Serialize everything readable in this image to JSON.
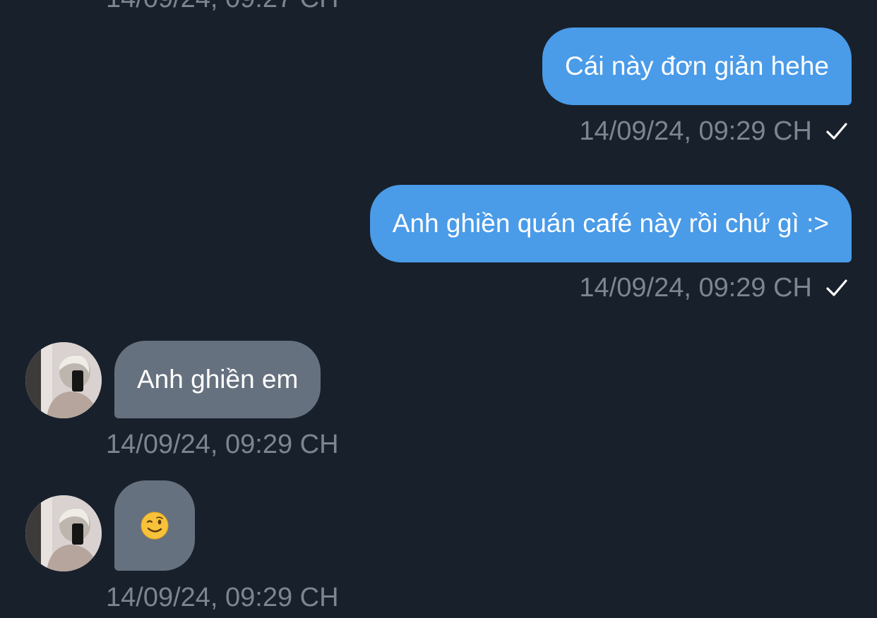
{
  "messages": [
    {
      "direction": "outgoing",
      "text": "Cái này đơn giản hehe",
      "timestamp": "14/09/24, 09:29 CH",
      "status_icon": "check-icon"
    },
    {
      "direction": "outgoing",
      "text": "Anh ghiền quán café này rồi chứ gì :>",
      "timestamp": "14/09/24, 09:29 CH",
      "status_icon": "check-icon"
    },
    {
      "direction": "incoming",
      "text": "Anh ghiền em",
      "timestamp": "14/09/24, 09:29 CH",
      "avatar": "avatar-photo"
    },
    {
      "direction": "incoming",
      "emoji": "winking-face-emoji",
      "timestamp": "14/09/24, 09:29 CH",
      "avatar": "avatar-photo"
    }
  ],
  "previous_timestamp_partial": "14/09/24, 09:27 CH",
  "colors": {
    "background": "#18202b",
    "outgoing_bubble": "#4a9be8",
    "incoming_bubble": "#66717f",
    "timestamp_text": "#7c8590",
    "message_text": "#ffffff"
  }
}
